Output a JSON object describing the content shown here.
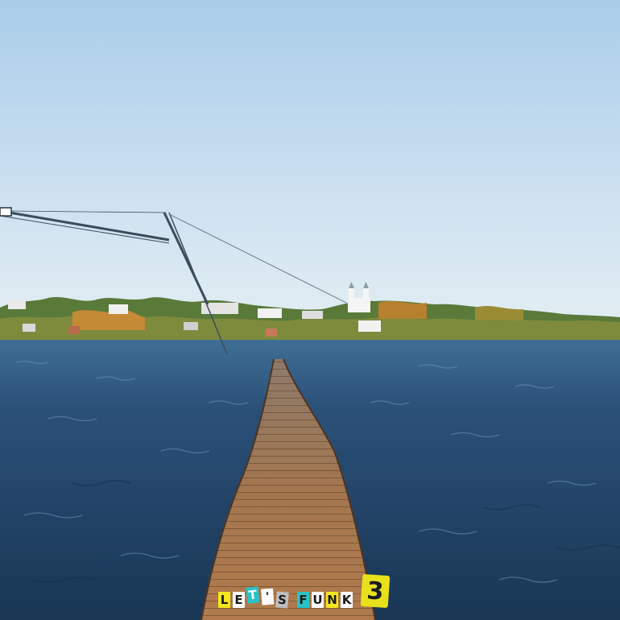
{
  "logo": {
    "letters": [
      "L",
      "E",
      "T",
      "'",
      "S",
      "F",
      "U",
      "N",
      "K"
    ],
    "number": "3"
  },
  "colors": {
    "sky_top": "#a8cbe9",
    "sky_bottom": "#e3eef4",
    "water_deep": "#1c3c5e",
    "water_light": "#3d6f9a",
    "boardwalk": "#a0704a",
    "logo_yellow": "#f4e81c",
    "logo_teal": "#27c3c7"
  }
}
